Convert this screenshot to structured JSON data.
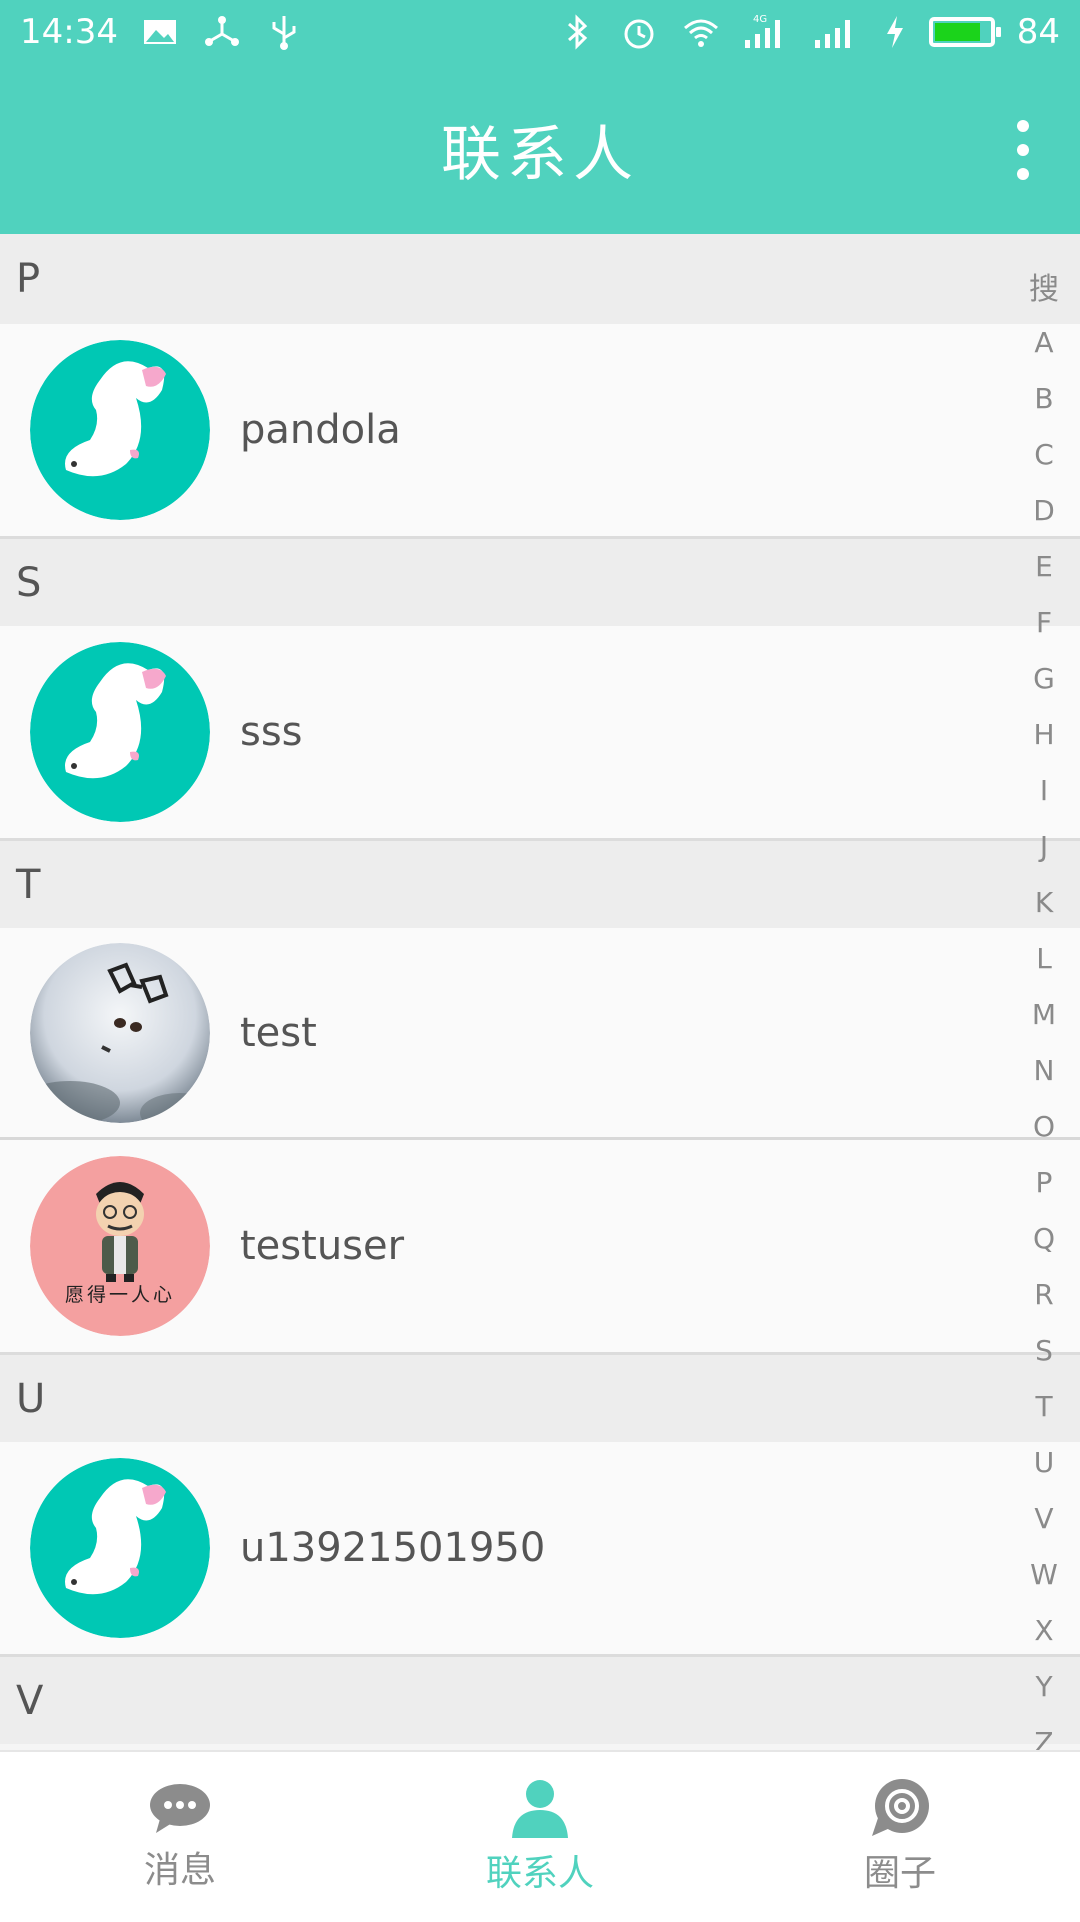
{
  "status_bar": {
    "time": "14:34",
    "battery": "84",
    "battery_level": 0.84,
    "battery_color": "#1bd31b",
    "network": "4G"
  },
  "app_bar": {
    "title": "联系人",
    "more_icon": "more-vert-icon"
  },
  "sections": [
    {
      "letter": "P",
      "contacts": [
        {
          "name": "pandola",
          "avatar": "fish-avatar"
        }
      ]
    },
    {
      "letter": "S",
      "contacts": [
        {
          "name": "sss",
          "avatar": "fish-avatar"
        }
      ]
    },
    {
      "letter": "T",
      "contacts": [
        {
          "name": "test",
          "avatar": "snow-glasses-avatar"
        },
        {
          "name": "testuser",
          "avatar": "cartoon-man-avatar"
        }
      ]
    },
    {
      "letter": "U",
      "contacts": [
        {
          "name": "u13921501950",
          "avatar": "fish-avatar"
        }
      ]
    },
    {
      "letter": "V",
      "contacts": []
    }
  ],
  "avatar_caption": "愿得一人心",
  "alpha_index": {
    "search": "搜",
    "letters": [
      "A",
      "B",
      "C",
      "D",
      "E",
      "F",
      "G",
      "H",
      "I",
      "J",
      "K",
      "L",
      "M",
      "N",
      "O",
      "P",
      "Q",
      "R",
      "S",
      "T",
      "U",
      "V",
      "W",
      "X",
      "Y",
      "Z"
    ]
  },
  "bottom_nav": [
    {
      "label": "消息",
      "icon": "chat-bubble-icon",
      "active": false
    },
    {
      "label": "联系人",
      "icon": "person-icon",
      "active": true
    },
    {
      "label": "圈子",
      "icon": "circle-target-icon",
      "active": false
    }
  ],
  "colors": {
    "accent": "#50d2be",
    "fish_bg": "#00c8b4",
    "cartoon_bg": "#f4a0a0"
  }
}
